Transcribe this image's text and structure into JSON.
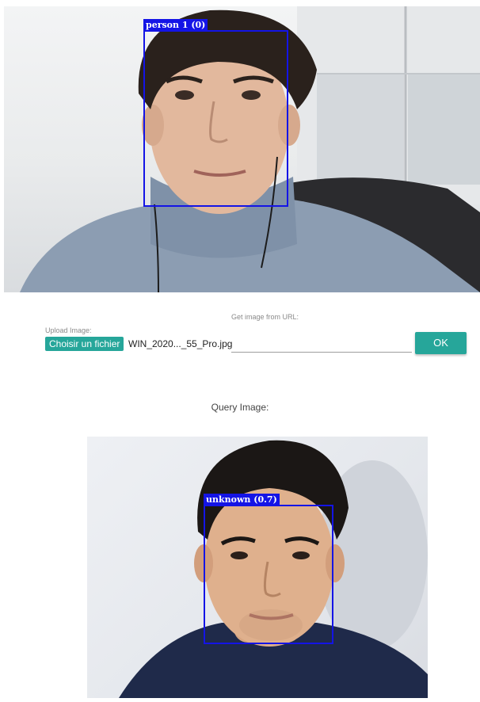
{
  "reference_image": {
    "face_label": "person 1 (0)"
  },
  "upload": {
    "label": "Upload Image:",
    "button_label": "Choisir un fichier",
    "file_name": "WIN_2020..._55_Pro.jpg"
  },
  "url": {
    "label": "Get image from URL:",
    "value": "",
    "placeholder": ""
  },
  "ok_button": {
    "label": "OK"
  },
  "query": {
    "title": "Query Image:",
    "face_label": "unknown (0.7)"
  },
  "colors": {
    "accent": "#26a69a",
    "face_box": "#1414e6"
  }
}
